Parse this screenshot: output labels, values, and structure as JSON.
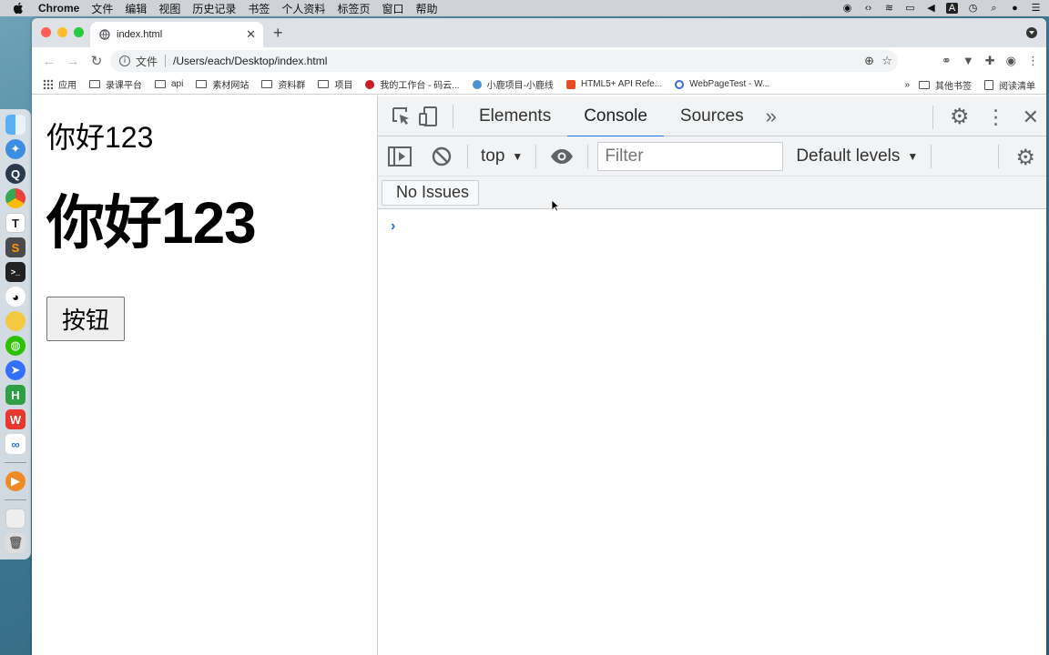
{
  "menubar": {
    "app_name": "Chrome",
    "items": [
      "文件",
      "编辑",
      "视图",
      "历史记录",
      "书签",
      "个人资料",
      "标签页",
      "窗口",
      "帮助"
    ]
  },
  "tab": {
    "title": "index.html"
  },
  "omnibox": {
    "scheme_label": "文件",
    "url": "/Users/each/Desktop/index.html"
  },
  "bookmarks": {
    "items": [
      "应用",
      "录课平台",
      "api",
      "素材网站",
      "资料群",
      "项目",
      "我的工作台 - 码云...",
      "小鹿项目-小鹿线",
      "HTML5+ API Refe...",
      "WebPageTest - W..."
    ],
    "overflow": "»",
    "other": "其他书签",
    "reading_list": "阅读清单"
  },
  "page": {
    "heading_small": "你好123",
    "heading_big": "你好123",
    "button_label": "按钮"
  },
  "devtools": {
    "tabs": [
      "Elements",
      "Console",
      "Sources"
    ],
    "active_tab": "Console",
    "more_tabs": "»",
    "context": "top",
    "filter_placeholder": "Filter",
    "levels": "Default levels",
    "issues_label": "No Issues",
    "prompt": "›"
  },
  "colors": {
    "accent": "#1a73e8",
    "traffic_red": "#ff5f57",
    "traffic_yellow": "#febc2e",
    "traffic_green": "#28c840"
  }
}
